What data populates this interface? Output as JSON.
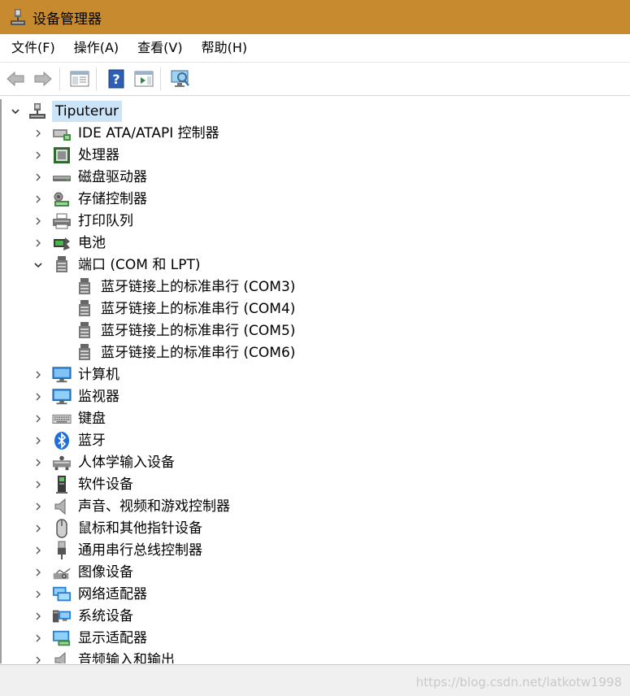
{
  "window": {
    "title": "设备管理器"
  },
  "menu": [
    "文件(F)",
    "操作(A)",
    "查看(V)",
    "帮助(H)"
  ],
  "tree": {
    "root": "Tiputerur",
    "categories": [
      {
        "label": "IDE ATA/ATAPI 控制器",
        "icon": "ide-controller-icon"
      },
      {
        "label": "处理器",
        "icon": "processor-icon"
      },
      {
        "label": "磁盘驱动器",
        "icon": "disk-drive-icon"
      },
      {
        "label": "存储控制器",
        "icon": "storage-controller-icon"
      },
      {
        "label": "打印队列",
        "icon": "printer-icon"
      },
      {
        "label": "电池",
        "icon": "battery-icon"
      },
      {
        "label": "端口 (COM 和 LPT)",
        "icon": "port-icon",
        "expanded": true
      },
      {
        "label": "计算机",
        "icon": "computer-icon"
      },
      {
        "label": "监视器",
        "icon": "monitor-icon"
      },
      {
        "label": "键盘",
        "icon": "keyboard-icon"
      },
      {
        "label": "蓝牙",
        "icon": "bluetooth-icon"
      },
      {
        "label": "人体学输入设备",
        "icon": "hid-icon"
      },
      {
        "label": "软件设备",
        "icon": "software-device-icon"
      },
      {
        "label": "声音、视频和游戏控制器",
        "icon": "sound-icon"
      },
      {
        "label": "鼠标和其他指针设备",
        "icon": "mouse-icon"
      },
      {
        "label": "通用串行总线控制器",
        "icon": "usb-icon"
      },
      {
        "label": "图像设备",
        "icon": "camera-icon"
      },
      {
        "label": "网络适配器",
        "icon": "network-adapter-icon"
      },
      {
        "label": "系统设备",
        "icon": "system-device-icon"
      },
      {
        "label": "显示适配器",
        "icon": "display-adapter-icon"
      },
      {
        "label": "音频输入和输出",
        "icon": "audio-io-icon"
      }
    ],
    "ports": [
      "蓝牙链接上的标准串行 (COM3)",
      "蓝牙链接上的标准串行 (COM4)",
      "蓝牙链接上的标准串行 (COM5)",
      "蓝牙链接上的标准串行 (COM6)"
    ]
  },
  "watermark": "https://blog.csdn.net/latkotw1998"
}
